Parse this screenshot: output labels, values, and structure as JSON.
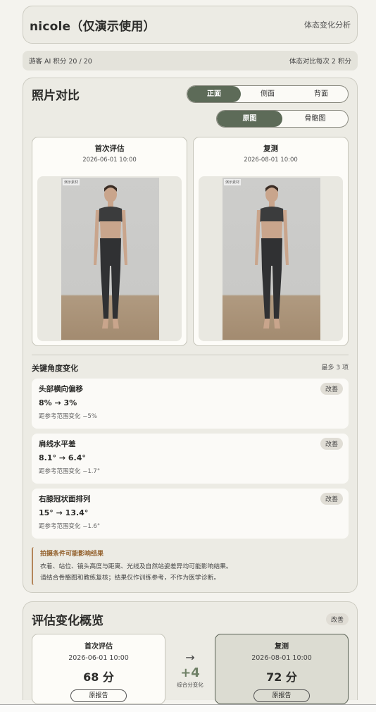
{
  "header": {
    "title": "nicole（仅演示使用）",
    "subtitle": "体态变化分析"
  },
  "credits": {
    "left": "游客 AI 积分 20 / 20",
    "right": "体态对比每次 2 积分"
  },
  "photo": {
    "title": "照片对比",
    "views": [
      "正面",
      "侧面",
      "背面"
    ],
    "modes": [
      "原图",
      "骨骼图"
    ],
    "tag": "演示素材",
    "cards": [
      {
        "label": "首次评估",
        "time": "2026-06-01 10:00"
      },
      {
        "label": "复测",
        "time": "2026-08-01 10:00"
      }
    ]
  },
  "angles": {
    "title": "关键角度变化",
    "max": "最多 3 项",
    "items": [
      {
        "name": "头部横向偏移",
        "value": "8% → 3%",
        "delta": "距参考范围变化 −5%",
        "badge": "改善"
      },
      {
        "name": "肩线水平差",
        "value": "8.1° → 6.4°",
        "delta": "距参考范围变化 −1.7°",
        "badge": "改善"
      },
      {
        "name": "右膝冠状面排列",
        "value": "15° → 13.4°",
        "delta": "距参考范围变化 −1.6°",
        "badge": "改善"
      }
    ]
  },
  "note": {
    "title": "拍摄条件可能影响结果",
    "line1": "衣着、站位、镜头高度与距离、光线及自然站姿差异均可能影响结果。",
    "line2": "请结合骨骼图和教练复核；结果仅作训练参考，不作为医学诊断。"
  },
  "summary": {
    "title": "评估变化概览",
    "badge": "改善",
    "first": {
      "label": "首次评估",
      "time": "2026-06-01 10:00",
      "score": "68 分",
      "button": "原报告"
    },
    "second": {
      "label": "复测",
      "time": "2026-08-01 10:00",
      "score": "72 分",
      "button": "原报告"
    },
    "arrow": "→",
    "delta": "+4",
    "delta_label": "综合分变化"
  }
}
